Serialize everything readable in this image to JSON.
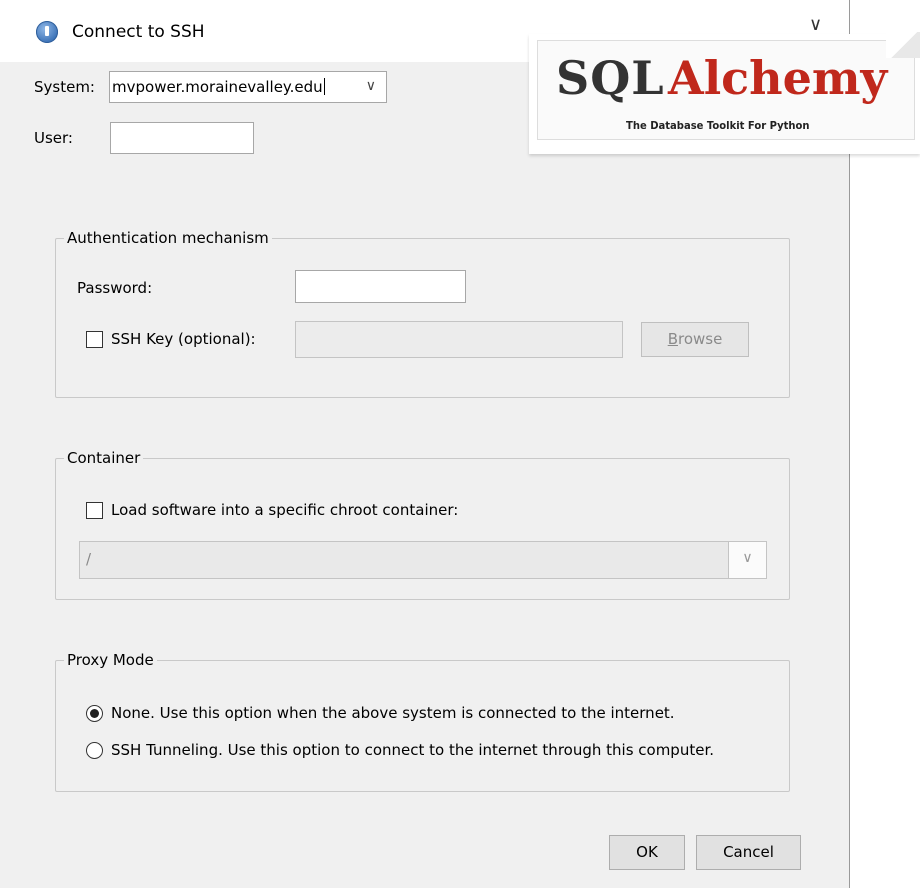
{
  "window": {
    "title": "Connect to SSH",
    "title_chevron": "∨"
  },
  "system": {
    "label": "System:",
    "value": "mvpower.morainevalley.edu",
    "arrow": "∨"
  },
  "user": {
    "label": "User:",
    "value": ""
  },
  "auth_group": {
    "legend": "Authentication mechanism",
    "password_label": "Password:",
    "password_value": "",
    "ssh_key_checkbox_label": "SSH Key (optional):",
    "ssh_key_checked": false,
    "ssh_key_path": "",
    "browse_prefix": "B",
    "browse_rest": "rowse"
  },
  "container_group": {
    "legend": "Container",
    "checkbox_label": "Load software into a specific chroot container:",
    "checked": false,
    "path_value": "/",
    "arrow": "∨"
  },
  "proxy_group": {
    "legend": "Proxy Mode",
    "options": [
      {
        "label": "None. Use this option when the above system is connected to the internet.",
        "selected": true
      },
      {
        "label": "SSH Tunneling. Use this option to connect to the internet through this computer.",
        "selected": false
      }
    ]
  },
  "buttons": {
    "ok": "OK",
    "cancel": "Cancel"
  },
  "logo": {
    "sql": "SQL",
    "alchemy": "Alchemy",
    "tagline": "The Database Toolkit For Python",
    "accent_color": "#c0281c"
  }
}
